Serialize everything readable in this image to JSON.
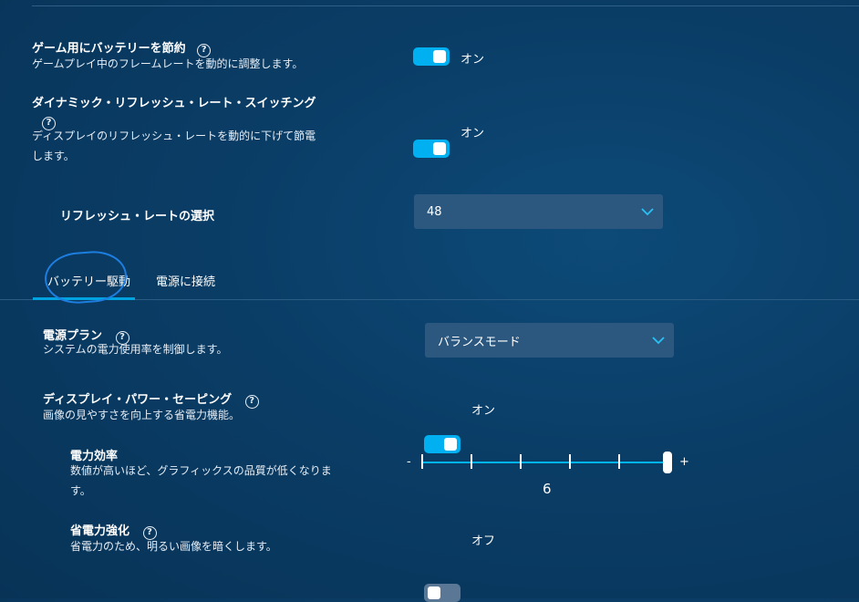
{
  "game_battery": {
    "title": "ゲーム用にバッテリーを節約",
    "description": "ゲームプレイ中のフレームレートを動的に調整します。",
    "state": "オン",
    "enabled": true
  },
  "dynamic_refresh": {
    "title": "ダイナミック・リフレッシュ・レート・スイッチング",
    "description_line1": "ディスプレイのリフレッシュ・レートを動的に下げて節電",
    "description_line2": "します。",
    "state": "オン",
    "enabled": true
  },
  "refresh_select": {
    "label": "リフレッシュ・レートの選択",
    "value": "48"
  },
  "tabs": [
    {
      "label": "バッテリー駆動",
      "active": true
    },
    {
      "label": "電源に接続",
      "active": false
    }
  ],
  "power_plan": {
    "title": "電源プラン",
    "description": "システムの電力使用率を制御します。",
    "value": "バランスモード"
  },
  "display_power_saving": {
    "title": "ディスプレイ・パワー・セーピング",
    "description": "画像の見やすさを向上する省電力機能。",
    "state": "オン",
    "enabled": true
  },
  "power_efficiency": {
    "title": "電力効率",
    "description_line1": "数値が高いほど、グラフィックスの品質が低くなりま",
    "description_line2": "す。",
    "minus": "-",
    "plus": "+",
    "value": "6",
    "max": 6
  },
  "power_boost": {
    "title": "省電力強化",
    "description": "省電力のため、明るい画像を暗くします。",
    "state": "オフ",
    "enabled": false
  },
  "help_symbol": "?",
  "colors": {
    "accent": "#00b0f0",
    "background": "#0a3d66",
    "dropdown": "#2c5880",
    "annotation_circle": "#1e7ee0"
  }
}
